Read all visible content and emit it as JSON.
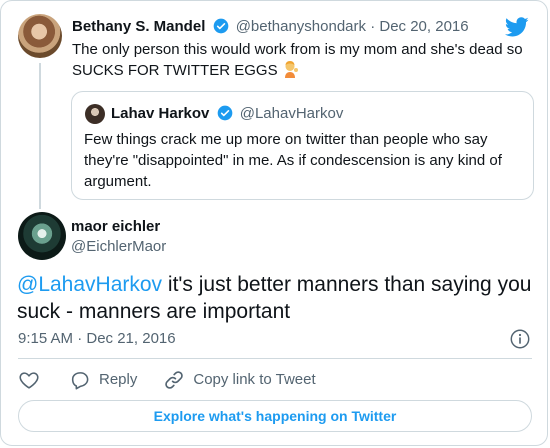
{
  "parent_tweet": {
    "author_name": "Bethany S. Mandel",
    "author_handle": "@bethanyshondark",
    "separator": "·",
    "date": "Dec 20, 2016",
    "text": "The only person this would work from is my mom and she's dead so SUCKS FOR TWITTER EGGS"
  },
  "quoted_tweet": {
    "author_name": "Lahav Harkov",
    "author_handle": "@LahavHarkov",
    "text": "Few things crack me up more on twitter than people who say they're \"disappointed\" in me. As if condescension is any kind of argument."
  },
  "main_tweet": {
    "author_name": "maor eichler",
    "author_handle": "@EichlerMaor",
    "mention": "@LahavHarkov",
    "text": " it's just better manners than saying you suck - manners are important",
    "timestamp": "9:15 AM · Dec 21, 2016"
  },
  "actions": {
    "reply_label": "Reply",
    "copy_link_label": "Copy link to Tweet"
  },
  "footer": {
    "explore_label": "Explore what's happening on Twitter"
  },
  "colors": {
    "accent": "#1d9bf0",
    "text": "#0f1419",
    "muted": "#536471",
    "border": "#cfd9de"
  },
  "icons": {
    "logo": "twitter-bird-icon",
    "verified": "verified-badge-icon",
    "emoji": "person-tipping-hand-emoji",
    "info": "info-icon",
    "like": "heart-icon",
    "reply": "reply-bubble-icon",
    "copy_link": "link-icon"
  }
}
